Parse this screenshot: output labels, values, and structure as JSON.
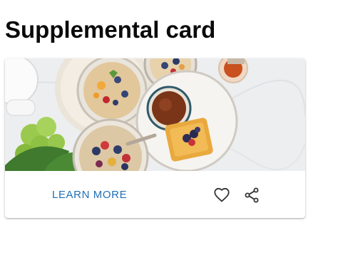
{
  "page": {
    "title": "Supplemental card"
  },
  "card": {
    "image": {
      "description_icon": "food-photo"
    },
    "actions": {
      "learn_more_label": "LEARN MORE",
      "favorite_icon": "heart-outline-icon",
      "share_icon": "share-icon"
    }
  },
  "colors": {
    "accent": "#1f6fb6",
    "icon": "#333333",
    "table": "#eef0f1"
  }
}
